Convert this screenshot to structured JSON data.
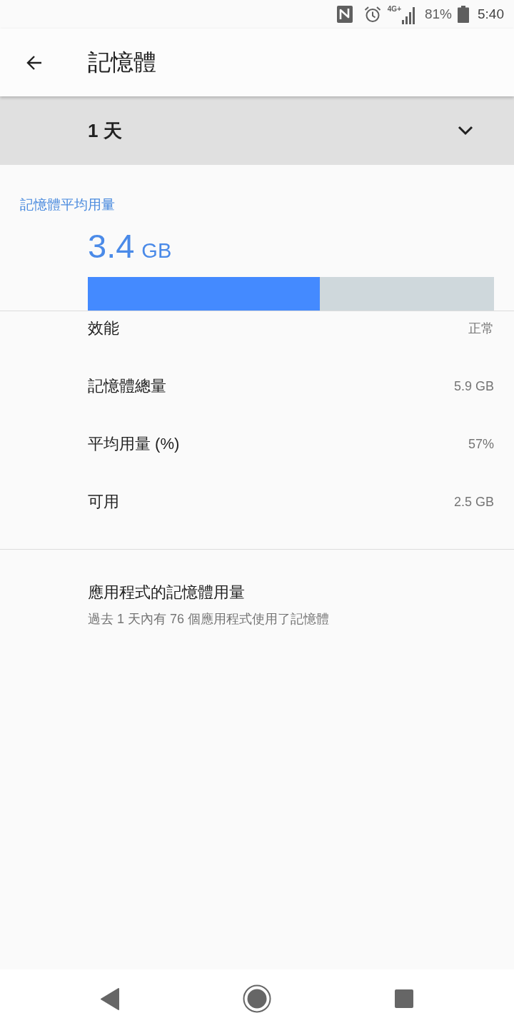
{
  "status_bar": {
    "network_type": "4G+",
    "battery_percent": "81%",
    "time": "5:40"
  },
  "toolbar": {
    "title": "記憶體"
  },
  "period_dropdown": {
    "value": "1 天"
  },
  "average_usage": {
    "label": "記憶體平均用量",
    "value": "3.4",
    "unit": "GB",
    "level": 0.571
  },
  "stats": [
    {
      "label": "效能",
      "value": "正常"
    },
    {
      "label": "記憶體總量",
      "value": "5.9 GB"
    },
    {
      "label": "平均用量 (%)",
      "value": "57%"
    },
    {
      "label": "可用",
      "value": "2.5 GB"
    }
  ],
  "app_usage": {
    "title": "應用程式的記憶體用量",
    "summary": "過去 1 天內有 76 個應用程式使用了記憶體"
  }
}
